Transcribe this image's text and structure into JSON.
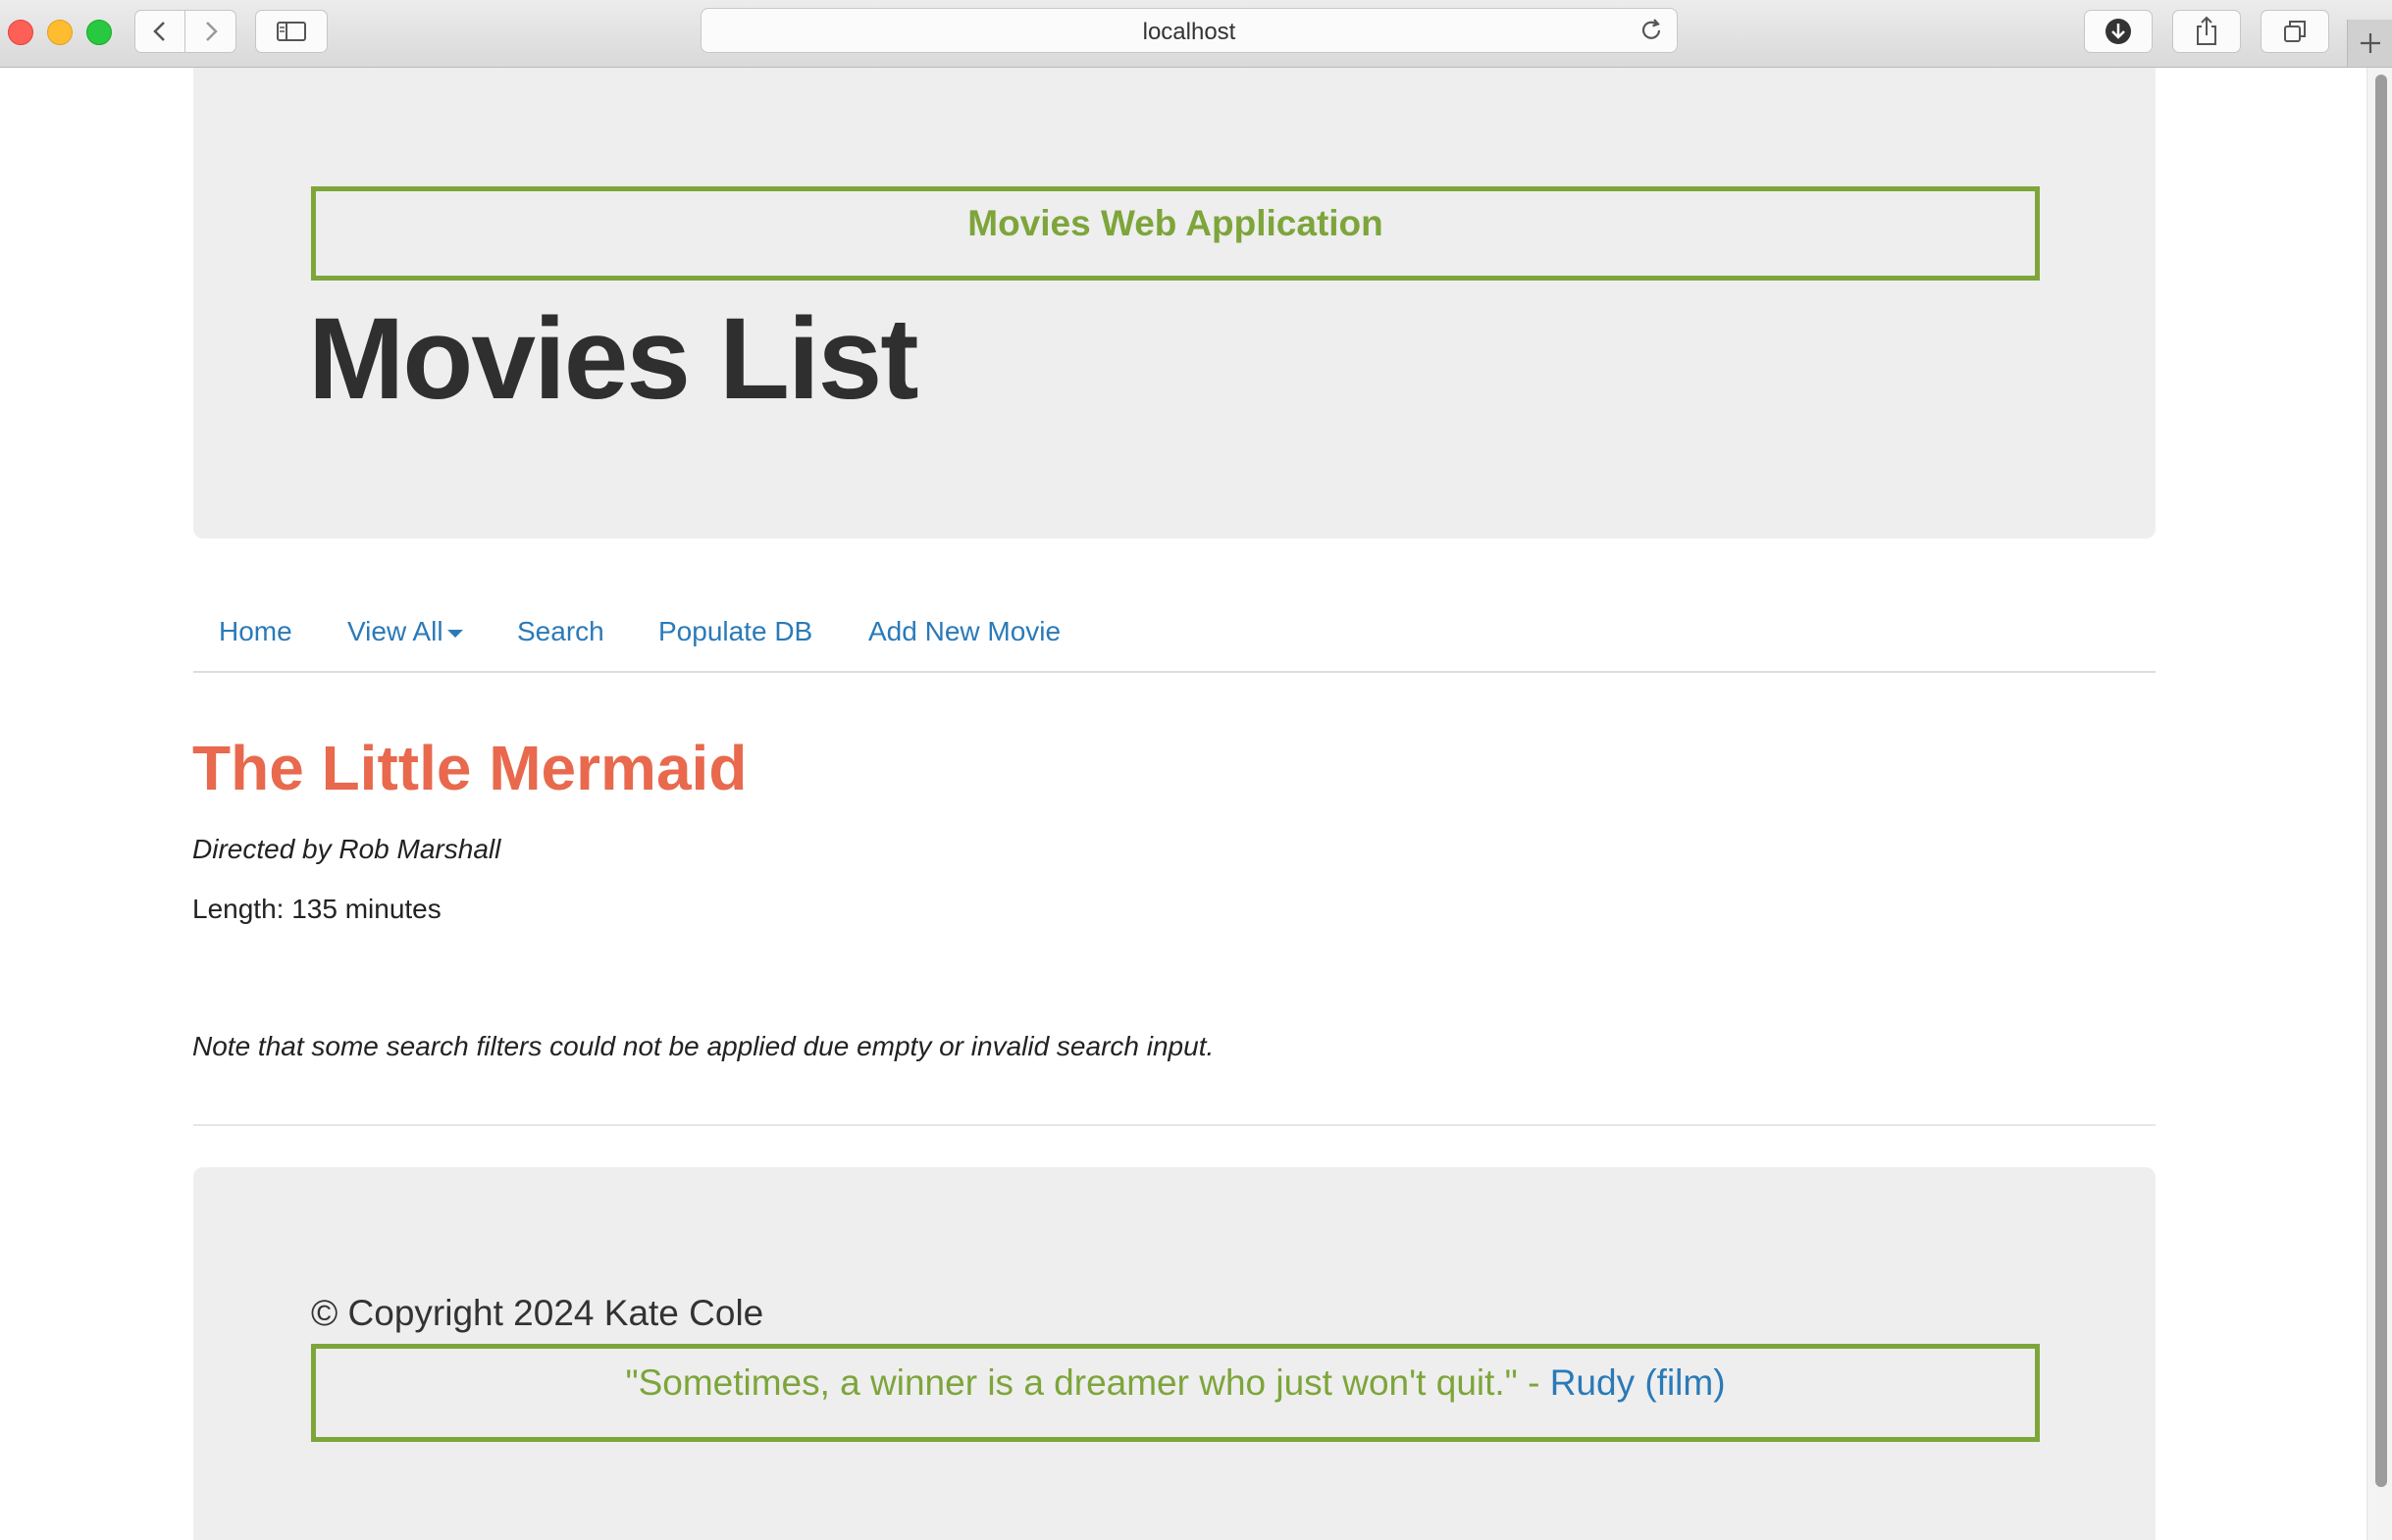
{
  "browser": {
    "url": "localhost"
  },
  "header": {
    "app_title": "Movies Web Application",
    "page_heading": "Movies List"
  },
  "nav": {
    "items": [
      {
        "label": "Home"
      },
      {
        "label": "View All",
        "has_dropdown": true
      },
      {
        "label": "Search"
      },
      {
        "label": "Populate DB"
      },
      {
        "label": "Add New Movie"
      }
    ]
  },
  "movie": {
    "title": "The Little Mermaid",
    "director_line": "Directed by Rob Marshall",
    "length_line": "Length: 135 minutes"
  },
  "note": "Note that some search filters could not be applied due empty or invalid search input.",
  "footer": {
    "copyright": "© Copyright 2024 Kate Cole",
    "quote_text": "\"Sometimes, a winner is a dreamer who just won't quit.\" - ",
    "quote_source": "Rudy (film)"
  },
  "colors": {
    "accent_green": "#7da53a",
    "link_blue": "#2a7ab8",
    "title_orange": "#e8694d",
    "panel_gray": "#eeeeee"
  },
  "icons": [
    "back-icon",
    "forward-icon",
    "sidebar-icon",
    "reload-icon",
    "download-icon",
    "share-icon",
    "tabs-icon",
    "plus-icon"
  ]
}
